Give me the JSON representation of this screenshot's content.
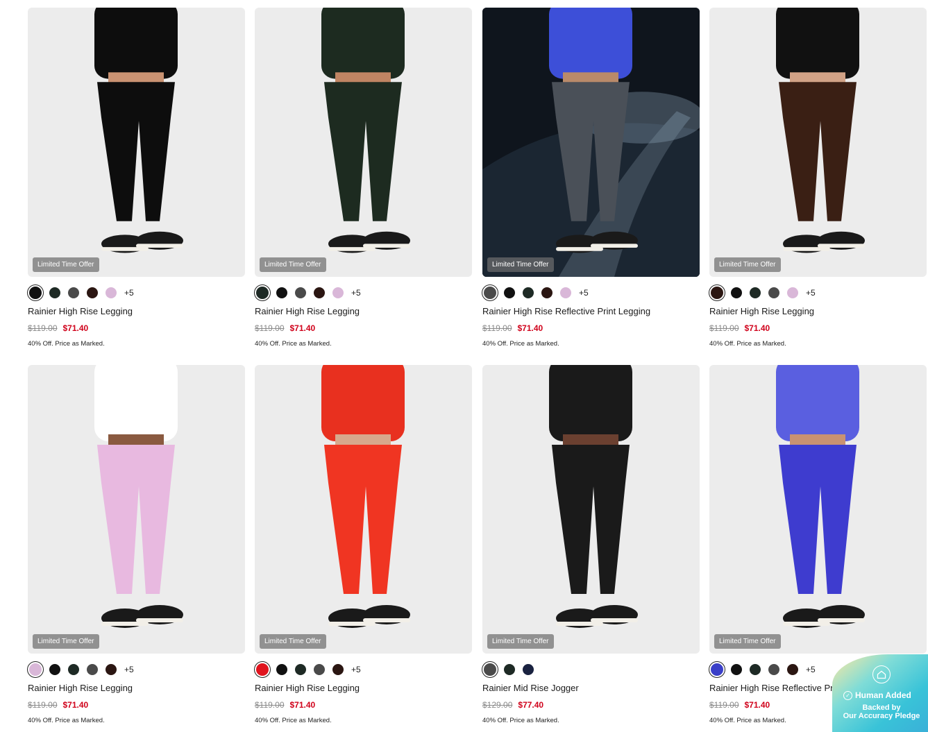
{
  "products": [
    {
      "name": "Rainier High Rise Legging",
      "badge": "Limited Time Offer",
      "was": "$119.00",
      "now": "$71.40",
      "promo": "40% Off. Price as Marked.",
      "more": "+5",
      "swatches": [
        "#111111",
        "#1e2a25",
        "#4a4a4a",
        "#2b1612",
        "#d9b7d8"
      ],
      "selected": 0,
      "scene": {
        "bg": "#ececec",
        "pants": "#0d0d0d",
        "top": "#0d0d0d",
        "skin": "#c99272"
      }
    },
    {
      "name": "Rainier High Rise Legging",
      "badge": "Limited Time Offer",
      "was": "$119.00",
      "now": "$71.40",
      "promo": "40% Off. Price as Marked.",
      "more": "+5",
      "swatches": [
        "#1e2a25",
        "#111111",
        "#4a4a4a",
        "#2b1612",
        "#d9b7d8"
      ],
      "selected": 0,
      "scene": {
        "bg": "#ececec",
        "pants": "#1d2b20",
        "top": "#1d2b20",
        "skin": "#c08563"
      }
    },
    {
      "name": "Rainier High Rise Reflective Print Legging",
      "badge": "Limited Time Offer",
      "was": "$119.00",
      "now": "$71.40",
      "promo": "40% Off. Price as Marked.",
      "more": "+5",
      "swatches": [
        "#4a4a4a",
        "#111111",
        "#1e2a25",
        "#2b1612",
        "#d9b7d8"
      ],
      "selected": 0,
      "scene": {
        "bg": "#1b2430",
        "pants": "#4a5058",
        "top": "#3d4fd8",
        "skin": "#b98a6a"
      }
    },
    {
      "name": "Rainier High Rise Legging",
      "badge": "Limited Time Offer",
      "was": "$119.00",
      "now": "$71.40",
      "promo": "40% Off. Price as Marked.",
      "more": "+5",
      "swatches": [
        "#2b1612",
        "#111111",
        "#1e2a25",
        "#4a4a4a",
        "#d9b7d8"
      ],
      "selected": 0,
      "scene": {
        "bg": "#ececec",
        "pants": "#3a1f14",
        "top": "#111111",
        "skin": "#d1a286"
      }
    },
    {
      "name": "Rainier High Rise Legging",
      "badge": "Limited Time Offer",
      "was": "$119.00",
      "now": "$71.40",
      "promo": "40% Off. Price as Marked.",
      "more": "+5",
      "swatches": [
        "#d9b7d8",
        "#111111",
        "#1e2a25",
        "#4a4a4a",
        "#2b1612"
      ],
      "selected": 0,
      "scene": {
        "bg": "#ececec",
        "pants": "#e8b9e0",
        "top": "#ffffff",
        "skin": "#8a5a40"
      }
    },
    {
      "name": "Rainier High Rise Legging",
      "badge": "Limited Time Offer",
      "was": "$119.00",
      "now": "$71.40",
      "promo": "40% Off. Price as Marked.",
      "more": "+5",
      "swatches": [
        "#e0141e",
        "#111111",
        "#1e2a25",
        "#4a4a4a",
        "#2b1612"
      ],
      "selected": 0,
      "scene": {
        "bg": "#ececec",
        "pants": "#f03522",
        "top": "#e8301f",
        "skin": "#d7a88c"
      }
    },
    {
      "name": "Rainier Mid Rise Jogger",
      "badge": "Limited Time Offer",
      "was": "$129.00",
      "now": "$77.40",
      "promo": "40% Off. Price as Marked.",
      "more": "",
      "swatches": [
        "#4a4a4a",
        "#1e2a25",
        "#1a2240"
      ],
      "selected": 0,
      "scene": {
        "bg": "#ececec",
        "pants": "#1a1a1a",
        "top": "#1a1a1a",
        "skin": "#6b4030"
      }
    },
    {
      "name": "Rainier High Rise Reflective Print Legging",
      "badge": "Limited Time Offer",
      "was": "$119.00",
      "now": "$71.40",
      "promo": "40% Off. Price as Marked.",
      "more": "+5",
      "swatches": [
        "#3a3fc8",
        "#111111",
        "#1e2a25",
        "#4a4a4a",
        "#2b1612"
      ],
      "selected": 0,
      "scene": {
        "bg": "#ececec",
        "pants": "#3e3ccf",
        "top": "#5a5fe0",
        "skin": "#c99272"
      }
    }
  ],
  "pledge": {
    "line1": "Human Added",
    "line2": "Backed by",
    "line3": "Our Accuracy Pledge"
  }
}
